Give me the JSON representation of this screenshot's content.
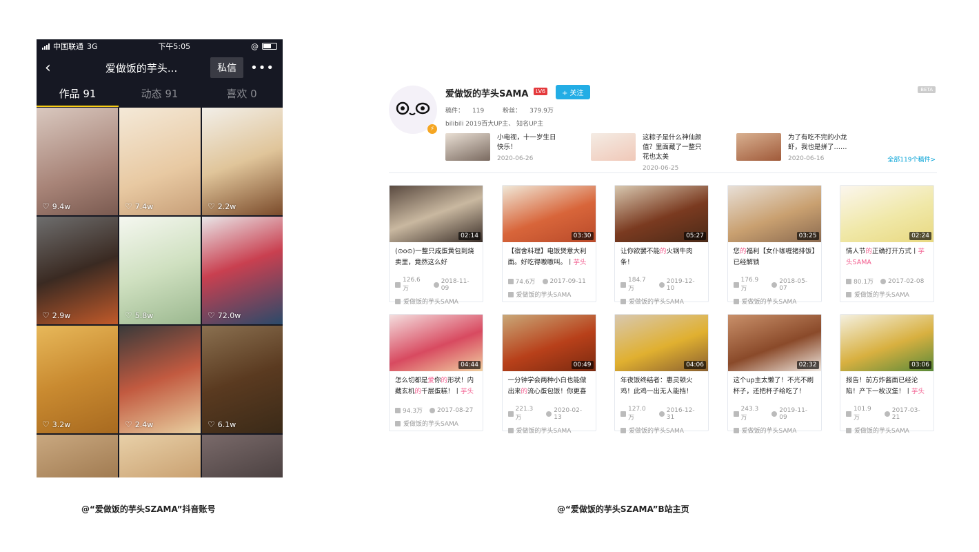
{
  "douyin": {
    "carrier": "中国联通",
    "network": "3G",
    "time": "下午5:05",
    "back_icon": "back-chevron-icon",
    "title": "爱做饭的芋头...",
    "dm_label": "私信",
    "more_label": "•••",
    "tabs": [
      {
        "label": "作品 91"
      },
      {
        "label": "动态 91"
      },
      {
        "label": "喜欢 0"
      }
    ],
    "videos": [
      {
        "likes": "9.4w",
        "bg": "linear-gradient(160deg,#d9c8bf,#a88478 60%,#7a5a50)"
      },
      {
        "likes": "7.4w",
        "bg": "linear-gradient(160deg,#f4e9d8,#e8c9a2 60%,#c79f78)"
      },
      {
        "likes": "2.2w",
        "bg": "linear-gradient(160deg,#f2efe9,#e0c59a 50%,#7a4a2a)"
      },
      {
        "likes": "2.9w",
        "bg": "linear-gradient(160deg,#6e6e6e,#3a2a22 50%,#c25a2a)"
      },
      {
        "likes": "5.8w",
        "bg": "linear-gradient(160deg,#f5f7f0,#cfe0c0 50%,#9bb88f)"
      },
      {
        "likes": "72.0w",
        "bg": "linear-gradient(160deg,#e9e6e8,#c94050 45%,#2a4a6a)"
      },
      {
        "likes": "3.2w",
        "bg": "linear-gradient(160deg,#e7b85a,#c98a30 50%,#a86a20)"
      },
      {
        "likes": "2.4w",
        "bg": "linear-gradient(160deg,#3a3a3a,#c25a40 50%,#e8cfa0)"
      },
      {
        "likes": "6.1w",
        "bg": "linear-gradient(160deg,#8a7050,#5a3a20 50%,#3a2a18)"
      },
      {
        "likes": "",
        "bg": "linear-gradient(160deg,#c9a880,#a07a50)"
      },
      {
        "likes": "",
        "bg": "linear-gradient(160deg,#e8d0a8,#c9a070)"
      },
      {
        "likes": "",
        "bg": "linear-gradient(160deg,#7a6a6a,#4a4040)"
      }
    ],
    "caption": "@“爱做饭的芋头SZAMA”抖音账号"
  },
  "bilibili": {
    "name": "爱做饭的芋头SAMA",
    "level": "LV6",
    "follow_label": "+ 关注",
    "beta": "BETA",
    "uploads_label": "稿件：",
    "uploads": "119",
    "fans_label": "粉丝：",
    "fans": "379.9万",
    "desc": "bilibili 2019百大UP主、 知名UP主",
    "all_videos": "全部119个稿件>",
    "recent": [
      {
        "title": "小电视，十一岁生日快乐！",
        "date": "2020-06-26",
        "bg": "linear-gradient(160deg,#e9dfd4,#7a6a60)"
      },
      {
        "title": "这粽子是什么神仙颜值？里面藏了一整只花也太美",
        "date": "2020-06-25",
        "bg": "linear-gradient(160deg,#f4ece4,#f0c8b8)"
      },
      {
        "title": "为了有吃不完的小龙虾，我也是拼了……",
        "date": "2020-06-16",
        "bg": "linear-gradient(160deg,#d8b090,#a05a3a)"
      }
    ],
    "videos": [
      {
        "title_parts": [
          "(⊙o⊙)一整只咸蛋黄包到烧卖里，竟然这么好"
        ],
        "dur": "02:14",
        "plays": "126.6万",
        "date": "2018-11-09",
        "up": "爱做饭的芋头SAMA",
        "bg": "linear-gradient(160deg,#5a4a40,#c9b8a0 50%,#3a2e28)"
      },
      {
        "title_parts": [
          "【宿舍料理】电饭煲意大利面。好吃得嗷嗷叫。丨",
          "芋头"
        ],
        "dur": "03:30",
        "plays": "74.6万",
        "date": "2017-09-11",
        "up": "爱做饭的芋头SAMA",
        "bg": "linear-gradient(160deg,#f0e8d8,#d8653a 55%,#b84a2a)"
      },
      {
        "title_parts": [
          "让你欲罢不能",
          "的",
          "火锅牛肉条！"
        ],
        "dur": "05:27",
        "plays": "184.7万",
        "date": "2019-12-10",
        "up": "爱做饭的芋头SAMA",
        "bg": "linear-gradient(160deg,#d8c8b0,#7a3a20 55%,#4a2a18)"
      },
      {
        "title_parts": [
          "您",
          "的",
          "福利【女仆咖喱猪排饭】已经解锁"
        ],
        "dur": "03:25",
        "plays": "176.9万",
        "date": "2018-05-07",
        "up": "爱做饭的芋头SAMA",
        "bg": "linear-gradient(160deg,#e8e0d8,#c9a070 55%,#8a6a50)"
      },
      {
        "title_parts": [
          "情人节",
          "的",
          "正确打开方式丨",
          "芋头SAMA"
        ],
        "dur": "02:24",
        "plays": "80.1万",
        "date": "2017-02-08",
        "up": "爱做饭的芋头SAMA",
        "bg": "linear-gradient(160deg,#fbf6ee,#f0e8a8 55%,#e8d880)"
      },
      {
        "title_parts": [
          "怎么切都是",
          "爱",
          "你",
          "的",
          "形状！内藏玄机",
          "的",
          "千层蛋糕！丨",
          "芋头"
        ],
        "dur": "04:44",
        "plays": "94.3万",
        "date": "2017-08-27",
        "up": "爱做饭的芋头SAMA",
        "bg": "linear-gradient(160deg,#f4dede,#d84a60 55%,#f0d0a0)"
      },
      {
        "title_parts": [
          "一分钟学会两种小白也能做出来",
          "的",
          "流心蛋包饭！你更喜"
        ],
        "dur": "00:49",
        "plays": "221.3万",
        "date": "2020-02-13",
        "up": "爱做饭的芋头SAMA",
        "bg": "linear-gradient(160deg,#c9a878,#b8401a 55%,#7a2a10)"
      },
      {
        "title_parts": [
          "年夜饭终结者：惠灵顿火鸡！此鸡一出无人能挡！"
        ],
        "dur": "04:06",
        "plays": "127.0万",
        "date": "2016-12-31",
        "up": "爱做饭的芋头SAMA",
        "bg": "linear-gradient(160deg,#d8c8b0,#e0b030 55%,#8a6030)"
      },
      {
        "title_parts": [
          "这个up主太懒了！不光不刷杯子，还把杯子给吃了！"
        ],
        "dur": "02:32",
        "plays": "243.3万",
        "date": "2019-11-09",
        "up": "爱做饭的芋头SAMA",
        "bg": "linear-gradient(160deg,#c9906a,#8a4a2a 55%,#f0e8e0)"
      },
      {
        "title_parts": [
          "报告！前方炸酱面已经沦陷！产下一枚汉堡！丨",
          "芋头"
        ],
        "dur": "03:06",
        "plays": "101.9万",
        "date": "2017-03-21",
        "up": "爱做饭的芋头SAMA",
        "bg": "linear-gradient(160deg,#f4f0e0,#d8b040 55%,#5a8a3a)"
      }
    ],
    "caption": "@“爱做饭的芋头SZAMA”B站主页"
  },
  "colors": {
    "douyin_bg": "#161823",
    "douyin_tab_indicator": "#face15",
    "bili_blue": "#00a1d6",
    "bili_pink": "#f25d8e",
    "bili_follow": "#23ade5"
  }
}
